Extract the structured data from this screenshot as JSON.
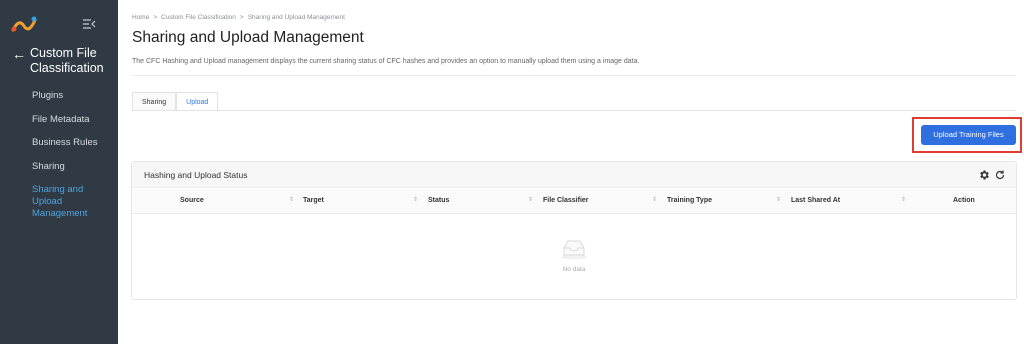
{
  "sidebar": {
    "section_title": "Custom File Classification",
    "items": [
      {
        "label": "Plugins"
      },
      {
        "label": "File Metadata"
      },
      {
        "label": "Business Rules"
      },
      {
        "label": "Sharing"
      },
      {
        "label": "Sharing and Upload Management"
      }
    ],
    "active_color": "#4fa3e0",
    "background": "#2f3a44"
  },
  "breadcrumb": [
    "Home",
    "Custom File Classification",
    "Sharing and Upload Management"
  ],
  "breadcrumb_separator": ">",
  "page": {
    "title": "Sharing and Upload Management",
    "description": "The CFC Hashing and Upload management displays the current sharing status of CFC hashes and provides an option to manually upload them using a image data."
  },
  "tabs": [
    {
      "label": "Sharing",
      "active": false
    },
    {
      "label": "Upload",
      "active": true
    }
  ],
  "upload_button": {
    "label": "Upload Training Files",
    "color": "#2f6fe0"
  },
  "panel": {
    "title": "Hashing and Upload Status",
    "columns": [
      "Source",
      "Target",
      "Status",
      "File Classifier",
      "Training Type",
      "Last Shared At",
      "Action"
    ],
    "empty_text": "No data"
  },
  "icons": {
    "logo": "brand-logo-icon",
    "collapse": "menu-collapse-icon",
    "back": "arrow-left-icon",
    "settings": "gear-icon",
    "refresh": "refresh-icon",
    "empty": "empty-inbox-icon",
    "sort": "sort-icon"
  }
}
